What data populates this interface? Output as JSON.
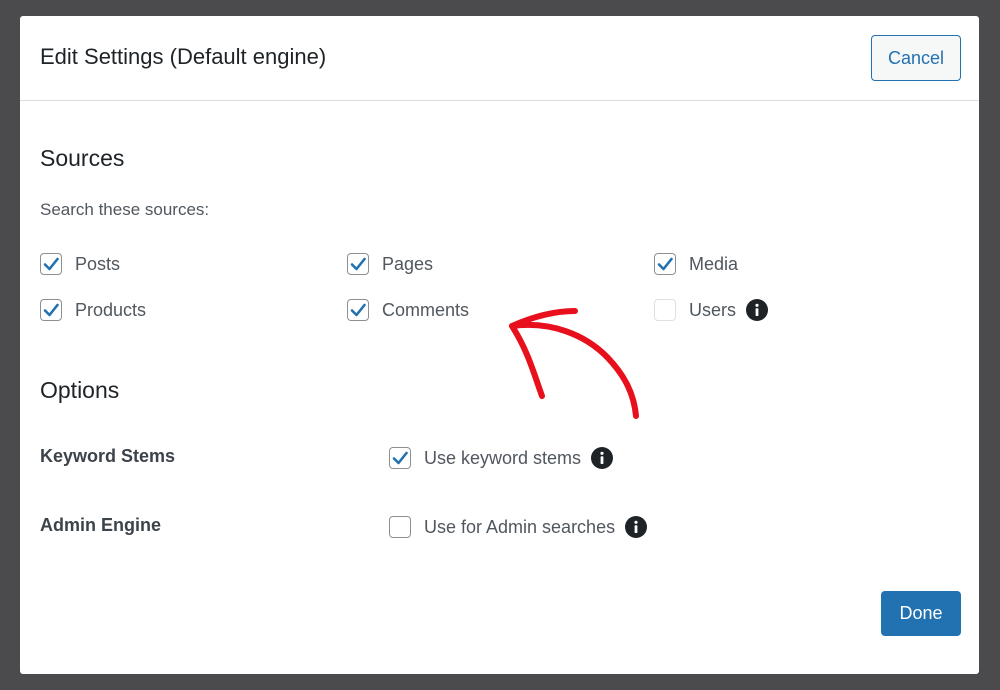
{
  "modal": {
    "title": "Edit Settings (Default engine)",
    "cancel_label": "Cancel",
    "done_label": "Done"
  },
  "sources": {
    "heading": "Sources",
    "intro": "Search these sources:",
    "items": [
      {
        "label": "Posts",
        "checked": true
      },
      {
        "label": "Pages",
        "checked": true
      },
      {
        "label": "Media",
        "checked": true
      },
      {
        "label": "Products",
        "checked": true
      },
      {
        "label": "Comments",
        "checked": true
      },
      {
        "label": "Users",
        "checked": false,
        "disabled": true,
        "info": true
      }
    ]
  },
  "options": {
    "heading": "Options",
    "rows": [
      {
        "label": "Keyword Stems",
        "checkbox_label": "Use keyword stems",
        "checked": true,
        "info": true
      },
      {
        "label": "Admin Engine",
        "checkbox_label": "Use for Admin searches",
        "checked": false,
        "info": true
      }
    ]
  },
  "colors": {
    "accent": "#2271b1",
    "annotation_arrow": "#e8101c",
    "backdrop": "#4b4b4d"
  },
  "icons": {
    "check": "checkmark-icon",
    "info": "info-icon",
    "annotation": "red-arrow-icon"
  }
}
